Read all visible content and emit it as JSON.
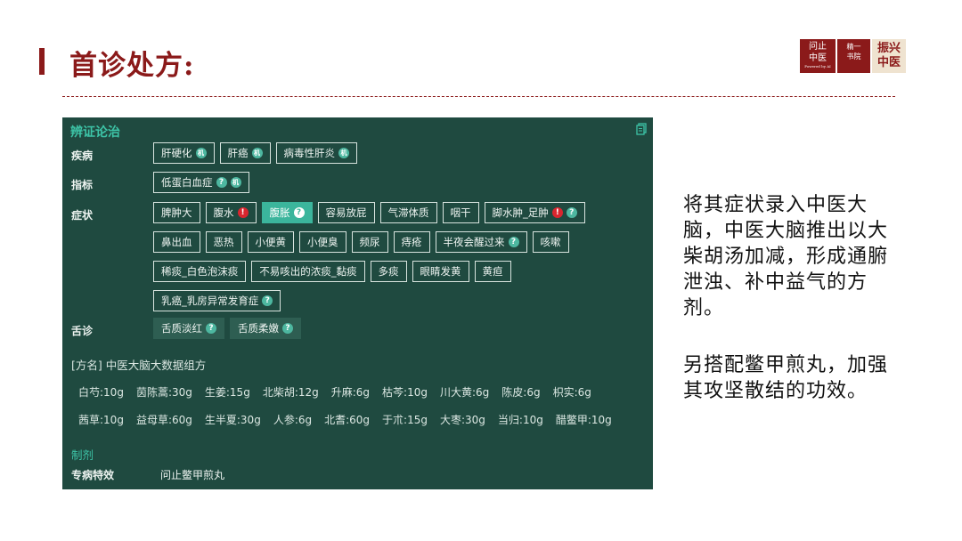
{
  "page": {
    "title": "首诊处方:",
    "logos": {
      "logo1_lines": [
        "问止",
        "中医"
      ],
      "logo1_sub": "Powered by AI",
      "logo2_lines": [
        "精一",
        "书院"
      ],
      "logo3_lines": [
        "振兴",
        "中医"
      ]
    }
  },
  "panel": {
    "header": "辨证论治",
    "rows": {
      "disease": {
        "label": "疾病",
        "tags": [
          "肝硬化",
          "肝癌",
          "病毒性肝炎"
        ]
      },
      "indicator": {
        "label": "指标",
        "tags": [
          "低蛋白血症"
        ]
      },
      "symptom": {
        "label": "症状",
        "tags": [
          "脾肿大",
          "腹水",
          "腹胀",
          "容易放屁",
          "气滞体质",
          "咽干",
          "脚水肿_足肿",
          "鼻出血",
          "恶热",
          "小便黄",
          "小便臭",
          "频尿",
          "痔疮",
          "半夜会醒过来",
          "咳嗽",
          "稀痰_白色泡沫痰",
          "不易咳出的浓痰_黏痰",
          "多痰",
          "眼睛发黄",
          "黄疸",
          "乳癌_乳房异常发育症"
        ]
      },
      "tongue": {
        "label": "舌诊",
        "tags": [
          "舌质淡红",
          "舌质柔嫩"
        ]
      }
    },
    "formula": {
      "name": "[方名] 中医大脑大数据组方",
      "herbs_row1": [
        "白芍:10g",
        "茵陈蒿:30g",
        "生姜:15g",
        "北柴胡:12g",
        "升麻:6g",
        "枯芩:10g",
        "川大黄:6g",
        "陈皮:6g",
        "枳实:6g"
      ],
      "herbs_row2": [
        "茜草:10g",
        "益母草:60g",
        "生半夏:30g",
        "人参:6g",
        "北耆:60g",
        "于朮:15g",
        "大枣:30g",
        "当归:10g",
        "醋鳖甲:10g"
      ]
    },
    "preparation": {
      "header": "制剂",
      "label": "专病特效",
      "value": "问止鳖甲煎丸"
    }
  },
  "description": {
    "paragraph1": "将其症状录入中医大脑，中医大脑推出以大柴胡汤加减，形成通腑泄浊、补中益气的方剂。",
    "paragraph2": "另搭配鳖甲煎丸，加强其攻坚散结的功效。"
  },
  "colors": {
    "brand_red": "#8b1a1a",
    "panel_bg": "#1f4a40",
    "accent_teal": "#3dc4a7",
    "active_tag": "#3bb59c",
    "alert_red": "#d9262f"
  }
}
